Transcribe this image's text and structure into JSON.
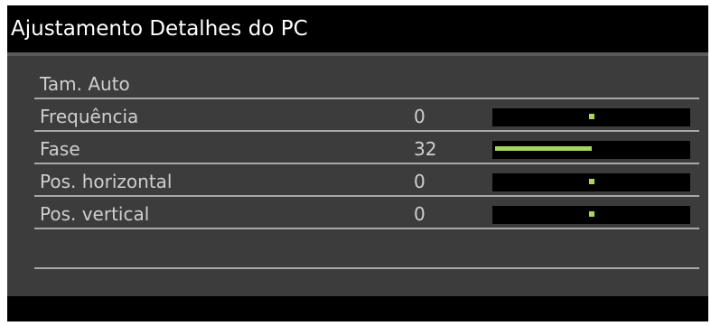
{
  "window": {
    "title": "Ajustamento Detalhes do PC"
  },
  "menu": {
    "items": [
      {
        "label": "Tam. Auto",
        "value": ""
      },
      {
        "label": "Frequência",
        "value": "0",
        "slider": {
          "mode": "center",
          "level": 0.5
        }
      },
      {
        "label": "Fase",
        "value": "32",
        "slider": {
          "mode": "fill",
          "level": 0.5
        }
      },
      {
        "label": "Pos. horizontal",
        "value": "0",
        "slider": {
          "mode": "center",
          "level": 0.5
        }
      },
      {
        "label": "Pos. vertical",
        "value": "0",
        "slider": {
          "mode": "center",
          "level": 0.5
        }
      }
    ]
  },
  "colors": {
    "accent": "#a6d65c",
    "panel_bg": "#3c3c3c",
    "text": "#cfcfcf",
    "title_text": "#ffffff"
  }
}
